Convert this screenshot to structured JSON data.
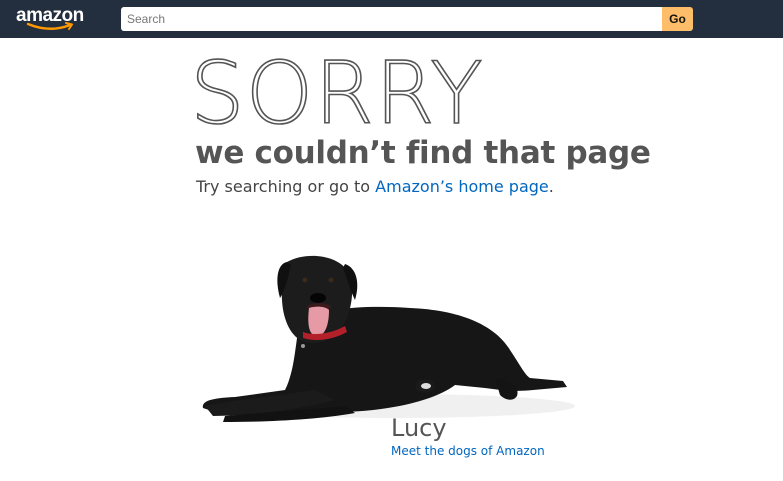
{
  "header": {
    "logo_text": "amazon",
    "search": {
      "placeholder": "Search",
      "value": ""
    },
    "go_label": "Go"
  },
  "main": {
    "headline": "SORRY",
    "subtitle": "we couldn’t find that page",
    "try_prefix": "Try searching or go to ",
    "home_link": "Amazon’s home page",
    "try_suffix": "."
  },
  "dog": {
    "name": "Lucy",
    "link": "Meet the dogs of Amazon"
  },
  "colors": {
    "header_bg": "#232f3e",
    "go_button": "#febd69",
    "link": "#0066c0",
    "logo_smile": "#ff9900"
  }
}
